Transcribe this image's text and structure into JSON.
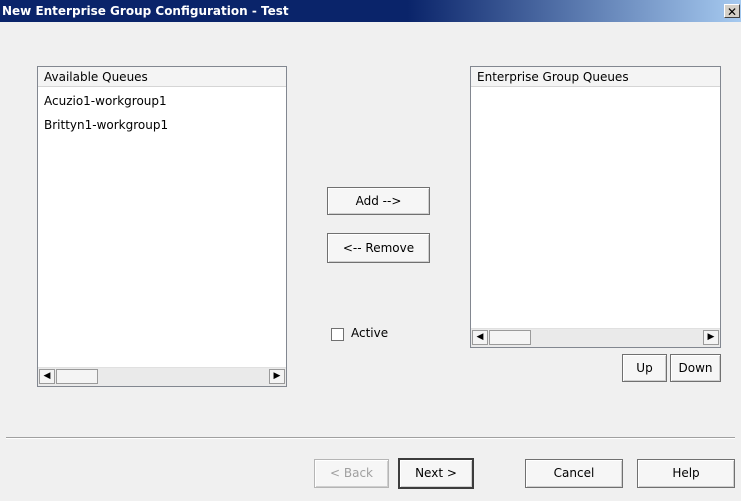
{
  "window": {
    "title": "New Enterprise Group Configuration - Test",
    "close_glyph": "✕"
  },
  "available_queues": {
    "header": "Available Queues",
    "items": [
      "Acuzio1-workgroup1",
      "Brittyn1-workgroup1"
    ]
  },
  "enterprise_group_queues": {
    "header": "Enterprise Group Queues",
    "items": []
  },
  "buttons": {
    "add": "Add -->",
    "remove": "<-- Remove",
    "up": "Up",
    "down": "Down",
    "back": "< Back",
    "next": "Next >",
    "cancel": "Cancel",
    "help": "Help"
  },
  "active_checkbox": {
    "label": "Active",
    "checked": false
  },
  "scroll_arrows": {
    "left": "◀",
    "right": "▶"
  }
}
